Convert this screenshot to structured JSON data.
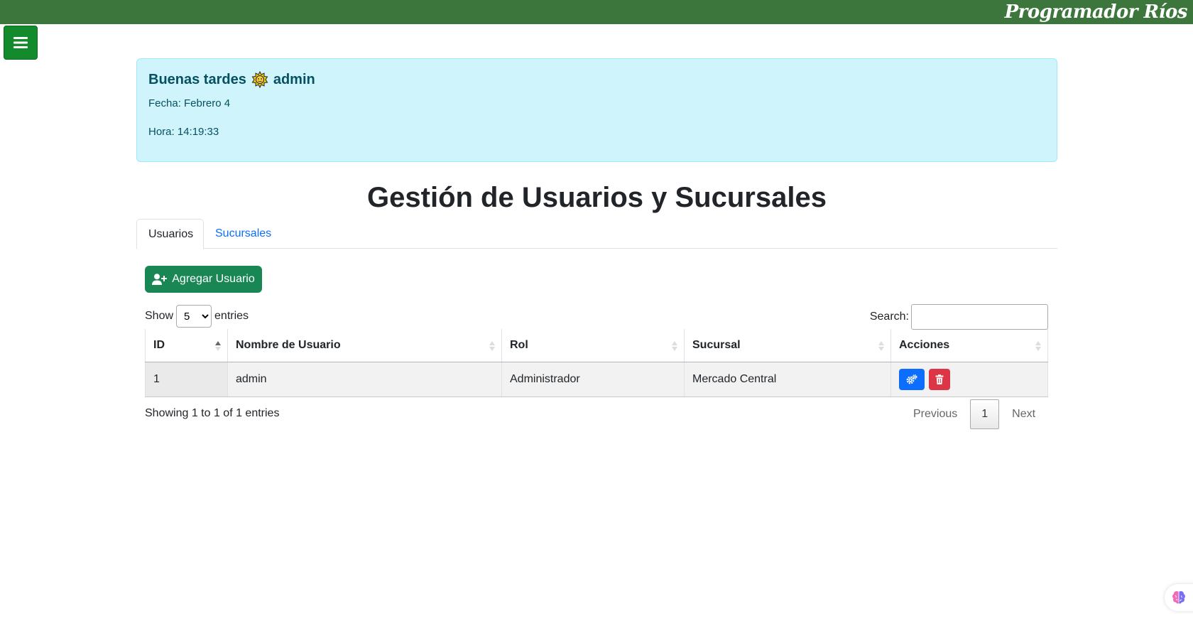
{
  "brand": "Programador Ríos",
  "greeting": {
    "title_prefix": "Buenas tardes",
    "user": "admin",
    "date_line": "Fecha: Febrero 4",
    "time_line": "Hora: 14:19:33"
  },
  "page_title": "Gestión de Usuarios y Sucursales",
  "tabs": [
    {
      "label": "Usuarios",
      "active": true
    },
    {
      "label": "Sucursales",
      "active": false
    }
  ],
  "add_button_label": "Agregar Usuario",
  "table_controls": {
    "show_label": "Show",
    "entries_label": "entries",
    "page_length": "5",
    "search_label": "Search:",
    "search_value": ""
  },
  "table": {
    "columns": [
      "ID",
      "Nombre de Usuario",
      "Rol",
      "Sucursal",
      "Acciones"
    ],
    "rows": [
      {
        "id": "1",
        "username": "admin",
        "role": "Administrador",
        "branch": "Mercado Central"
      }
    ]
  },
  "footer": {
    "info": "Showing 1 to 1 of 1 entries",
    "previous": "Previous",
    "current_page": "1",
    "next": "Next"
  },
  "icons": {
    "menu": "hamburger-icon",
    "greeting": "sun-icon",
    "add": "user-plus-icon",
    "edit": "cogs-icon",
    "delete": "trash-icon",
    "floating": "brain-icon"
  },
  "colors": {
    "topbar": "#3c763d",
    "menu_button": "#138a2b",
    "alert_bg": "#cff4fc",
    "add_button": "#198754",
    "edit_button": "#0d6efd",
    "delete_button": "#dc3545",
    "link": "#0d6efd"
  }
}
